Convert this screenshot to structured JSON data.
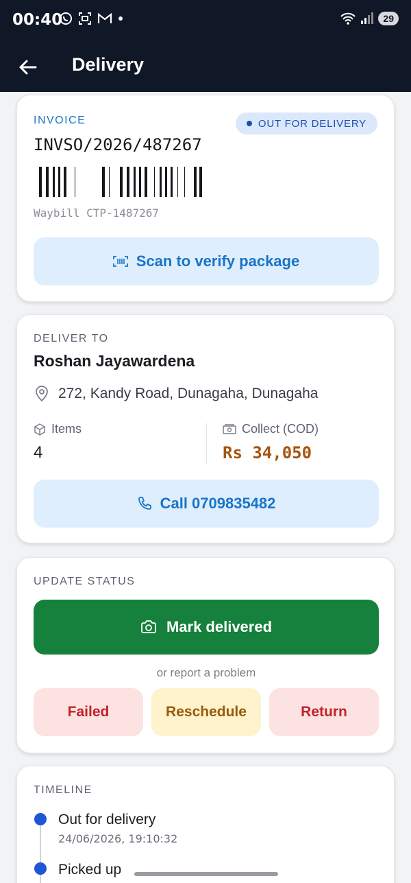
{
  "status_bar": {
    "time": "00:40",
    "battery": "29"
  },
  "app_bar": {
    "title": "Delivery"
  },
  "invoice": {
    "label": "INVOICE",
    "status_badge": "OUT FOR DELIVERY",
    "number": "INVSO/2026/487267",
    "waybill": "Waybill CTP-1487267",
    "scan_button": "Scan to verify package"
  },
  "delivery": {
    "label": "DELIVER TO",
    "customer_name": "Roshan Jayawardena",
    "address": "272, Kandy Road, Dunagaha, Dunagaha",
    "items_label": "Items",
    "items_value": "4",
    "cod_label": "Collect (COD)",
    "cod_value": "Rs 34,050",
    "call_button": "Call 0709835482"
  },
  "update_status": {
    "label": "UPDATE STATUS",
    "mark_delivered": "Mark delivered",
    "or_text": "or report a problem",
    "failed": "Failed",
    "reschedule": "Reschedule",
    "return": "Return"
  },
  "timeline": {
    "label": "TIMELINE",
    "events": [
      {
        "title": "Out for delivery",
        "time": "24/06/2026, 19:10:32"
      },
      {
        "title": "Picked up"
      }
    ]
  },
  "colors": {
    "header_bg": "#101726",
    "accent_blue": "#1a74c7",
    "primary_green": "#15813d",
    "cod_amount": "#a6550f"
  }
}
